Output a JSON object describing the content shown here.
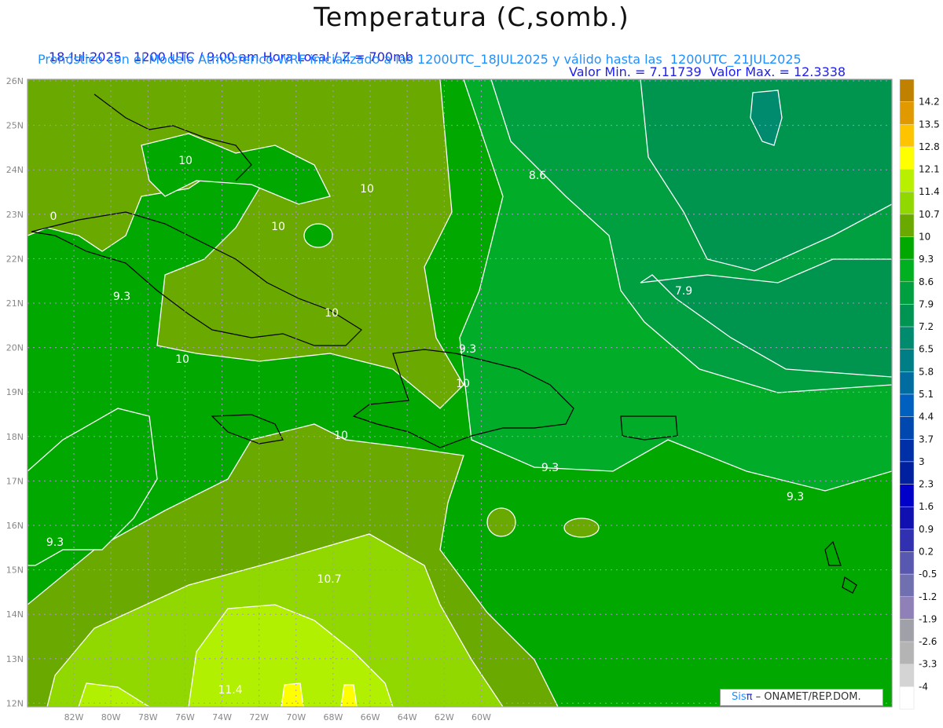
{
  "header": {
    "title": "Temperatura (C,somb.)",
    "date": "18-Jul-2025",
    "time": "1200 UTC / 9:00 am Hora Local / Z = 700mb",
    "min_label": "Valor Min. = 7.11739",
    "max_label": "Valor Max. = 12.3338",
    "subtitle": "Pronóstico con el Modelo Atmósferico WRF inicializado a las 1200UTC_18JUL2025 y válido hasta las  1200UTC_21JUL2025"
  },
  "axes": {
    "lat_labels": [
      "26N",
      "25N",
      "24N",
      "23N",
      "22N",
      "21N",
      "20N",
      "19N",
      "18N",
      "17N",
      "16N",
      "15N",
      "14N",
      "13N",
      "12N"
    ],
    "lon_labels": [
      "82W",
      "80W",
      "78W",
      "76W",
      "74W",
      "72W",
      "70W",
      "68W",
      "66W",
      "64W",
      "62W",
      "60W"
    ]
  },
  "colorbar": {
    "labels": [
      "14.2",
      "13.5",
      "12.8",
      "12.1",
      "11.4",
      "10.7",
      "10",
      "9.3",
      "8.6",
      "7.9",
      "7.2",
      "6.5",
      "5.8",
      "5.1",
      "4.4",
      "3.7",
      "3",
      "2.3",
      "1.6",
      "0.9",
      "0.2",
      "-0.5",
      "-1.2",
      "-1.9",
      "-2.6",
      "-3.3",
      "-4"
    ],
    "colors": [
      "#c08000",
      "#e09a00",
      "#ffc400",
      "#ffff00",
      "#b8f000",
      "#90d800",
      "#6aaa00",
      "#00a800",
      "#00b020",
      "#009f40",
      "#009452",
      "#008a6e",
      "#007e86",
      "#006ca0",
      "#0060c0",
      "#0048b0",
      "#0030a8",
      "#0020a0",
      "#0000c8",
      "#1010b0",
      "#3030b0",
      "#5858b0",
      "#7070b0",
      "#9080b8",
      "#a0a0a8",
      "#b4b4b4",
      "#d4d4d4",
      "#ffffff"
    ]
  },
  "contour_labels": [
    {
      "text": "10"
    },
    {
      "text": "10"
    },
    {
      "text": "10"
    },
    {
      "text": "9.3"
    },
    {
      "text": "10"
    },
    {
      "text": "10"
    },
    {
      "text": "9.3"
    },
    {
      "text": "10"
    },
    {
      "text": "10"
    },
    {
      "text": "8.6"
    },
    {
      "text": "7.9"
    },
    {
      "text": "9.3"
    },
    {
      "text": "9.3"
    },
    {
      "text": "9.3"
    },
    {
      "text": "10.7"
    },
    {
      "text": "11.4"
    },
    {
      "text": "0"
    }
  ],
  "logo": {
    "sis": "Sis",
    "pi": "π",
    "text": " –  ONAMET/REP.DOM."
  }
}
